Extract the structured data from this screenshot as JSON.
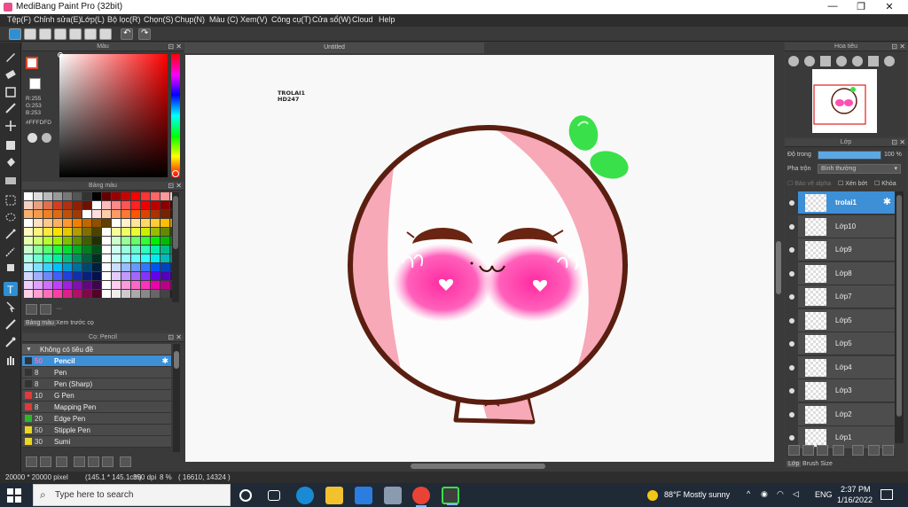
{
  "window": {
    "title": "MediBang Paint Pro (32bit)",
    "minimize": "—",
    "maximize": "❐",
    "close": "✕"
  },
  "menu": [
    "Tệp(F)",
    "Chỉnh sửa(E)",
    "Lớp(L)",
    "Bộ lọc(R)",
    "Chọn(S)",
    "Chụp(N)",
    "Màu (C)",
    "Xem(V)",
    "Công cụ(T)",
    "Cửa sổ(W)",
    "Cloud",
    "Help"
  ],
  "color_panel": {
    "title": "Màu",
    "r": "R:255",
    "g": "G:253",
    "b": "B:253",
    "hex": "#FFFDFD",
    "foreground": "#FFFDFD",
    "background": "#E0452B"
  },
  "palette_panel": {
    "title": "Bảng màu",
    "tab1": "Bảng màu",
    "tab2": "Xem trước cọ",
    "more": "···"
  },
  "brush_panel": {
    "title": "Cọ: Pencil",
    "group": "Không có tiêu đề",
    "items": [
      {
        "size": "50",
        "name": "Pencil",
        "color": "#333333",
        "selected": true
      },
      {
        "size": "8",
        "name": "Pen",
        "color": "#333333"
      },
      {
        "size": "8",
        "name": "Pen (Sharp)",
        "color": "#333333"
      },
      {
        "size": "10",
        "name": "G Pen",
        "color": "#e03a3a"
      },
      {
        "size": "8",
        "name": "Mapping Pen",
        "color": "#e03a3a"
      },
      {
        "size": "20",
        "name": "Edge Pen",
        "color": "#2bb82b"
      },
      {
        "size": "50",
        "name": "Stipple Pen",
        "color": "#e8d820"
      },
      {
        "size": "30",
        "name": "Sumi",
        "color": "#e8d820"
      }
    ]
  },
  "document": {
    "tab": "Untitled",
    "watermark_line1": "TROLAI1",
    "watermark_line2": "HD247"
  },
  "navigator": {
    "title": "Hoa tiêu"
  },
  "layers": {
    "title": "Lớp",
    "opacity_label": "Độ trong",
    "opacity_value": "100 %",
    "opacity": 1.0,
    "blend_label": "Pha trộn",
    "blend_value": "Bình thường",
    "protect_alpha": "Bảo vệ alpha",
    "clip": "Xén bớt",
    "lock": "Khóa",
    "items": [
      {
        "name": "trolai1",
        "selected": true
      },
      {
        "name": "Lớp10"
      },
      {
        "name": "Lớp9"
      },
      {
        "name": "Lớp8"
      },
      {
        "name": "Lớp7"
      },
      {
        "name": "Lớp5"
      },
      {
        "name": "Lớp5"
      },
      {
        "name": "Lớp4"
      },
      {
        "name": "Lớp3"
      },
      {
        "name": "Lớp2"
      },
      {
        "name": "Lớp1"
      }
    ],
    "tab1": "Lớp",
    "tab2": "Brush Size"
  },
  "status": {
    "size": "20000 * 20000 pixel",
    "cm": "(145.1 * 145.1cm)",
    "dpi": "350 dpi",
    "zoom": "8 %",
    "coords": "( 16610, 14324 )"
  },
  "taskbar": {
    "search_placeholder": "Type here to search",
    "weather": "88°F  Mostly sunny",
    "lang": "ENG",
    "time": "2:37 PM",
    "date": "1/16/2022"
  }
}
